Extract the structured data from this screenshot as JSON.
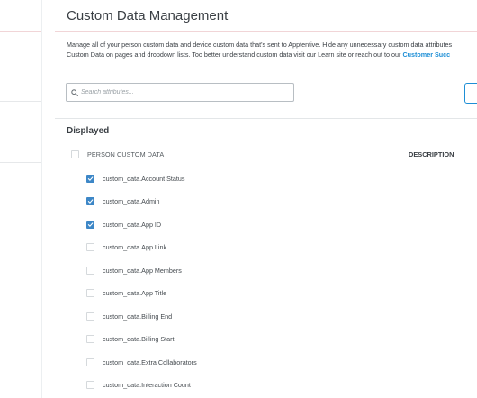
{
  "page": {
    "title": "Custom Data Management",
    "description_line1": "Manage all of your person custom data and device custom data that's sent to Apptentive. Hide any unnecessary custom data attributes",
    "description_line2_prefix": "Custom Data on pages and dropdown lists. Too better understand custom data visit our Learn site or reach out to our ",
    "description_link": "Customer Succ"
  },
  "search": {
    "placeholder": "Search attributes...",
    "value": ""
  },
  "section": {
    "title": "Displayed",
    "column_person": "PERSON CUSTOM DATA",
    "column_description": "DESCRIPTION"
  },
  "attributes": [
    {
      "label": "custom_data.Account Status",
      "checked": true
    },
    {
      "label": "custom_data.Admin",
      "checked": true
    },
    {
      "label": "custom_data.App ID",
      "checked": true
    },
    {
      "label": "custom_data.App Link",
      "checked": false
    },
    {
      "label": "custom_data.App Members",
      "checked": false
    },
    {
      "label": "custom_data.App Title",
      "checked": false
    },
    {
      "label": "custom_data.Billing End",
      "checked": false
    },
    {
      "label": "custom_data.Billing Start",
      "checked": false
    },
    {
      "label": "custom_data.Extra Collaborators",
      "checked": false
    },
    {
      "label": "custom_data.Interaction Count",
      "checked": false
    }
  ],
  "colors": {
    "accent": "#1e8fd6",
    "checkbox_checked": "#3d87c7",
    "title_rule": "#f1d5d7"
  },
  "icons": {
    "search": "search-icon",
    "check": "check-icon"
  }
}
